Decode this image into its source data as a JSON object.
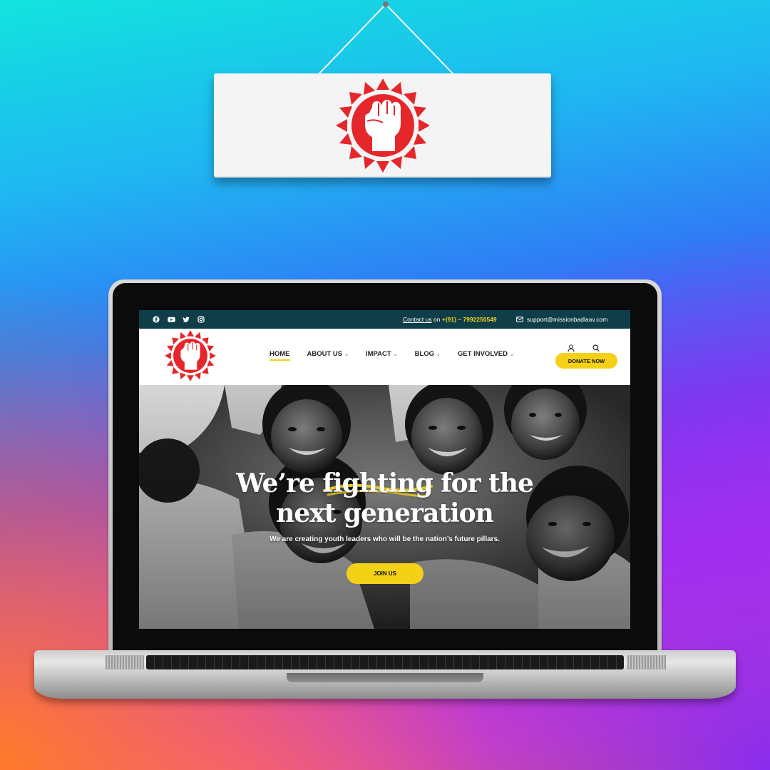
{
  "brand": {
    "accent_yellow": "#f3d117",
    "topbar_color": "#0f3e49",
    "logo_red": "#e5262b",
    "logo_icon": "raised-fist-sun-icon"
  },
  "topbar": {
    "social_icons": [
      "facebook-icon",
      "youtube-icon",
      "twitter-icon",
      "instagram-icon"
    ],
    "contact_link": "Contact us",
    "contact_on": " on ",
    "phone": "+(91) – 7992250549",
    "email": "support@missionbadlaav.com"
  },
  "nav": {
    "items": [
      {
        "label": "HOME",
        "active": true,
        "has_dropdown": false
      },
      {
        "label": "ABOUT US",
        "active": false,
        "has_dropdown": true
      },
      {
        "label": "IMPACT",
        "active": false,
        "has_dropdown": true
      },
      {
        "label": "BLOG",
        "active": false,
        "has_dropdown": true
      },
      {
        "label": "GET INVOLVED",
        "active": false,
        "has_dropdown": true
      }
    ],
    "donate_label": "DONATE NOW"
  },
  "hero": {
    "title_line1": "We’re fighting for the",
    "title_line2": "next generation",
    "subtitle": "We are creating youth leaders who will be the nation’s future pillars.",
    "cta_label": "JOIN US"
  }
}
